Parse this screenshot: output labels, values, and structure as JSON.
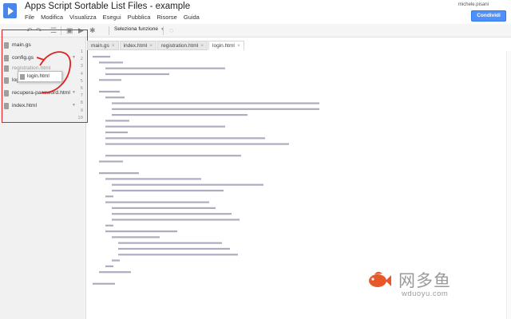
{
  "header": {
    "title": "Apps Script Sortable List Files - example",
    "user": "michele.pisani",
    "share_label": "Condividi",
    "menu": [
      "File",
      "Modifica",
      "Visualizza",
      "Esegui",
      "Pubblica",
      "Risorse",
      "Guida"
    ]
  },
  "toolbar": {
    "function_select": "Seleziona funzione",
    "icons": [
      "undo-icon",
      "redo-icon",
      "indent-icon",
      "save-icon",
      "run-icon",
      "debug-icon",
      "lightbulb-icon"
    ]
  },
  "sidebar": {
    "files": [
      "main.gs",
      "config.gs",
      "registration.html",
      "login.html",
      "recupera-password.html",
      "index.html"
    ],
    "drag_label": "login.html"
  },
  "tabs": [
    "main.gs",
    "index.html",
    "registration.html",
    "login.html"
  ],
  "line_numbers": [
    "1",
    "2",
    "3",
    "4",
    "5",
    "6",
    "7",
    "8",
    "9",
    "10"
  ],
  "watermark": {
    "text": "网多鱼",
    "url": "wduoyu.com"
  },
  "colors": {
    "accent": "#4d90fe",
    "highlight_box": "#e02020",
    "watermark_fish": "#e8572a"
  }
}
